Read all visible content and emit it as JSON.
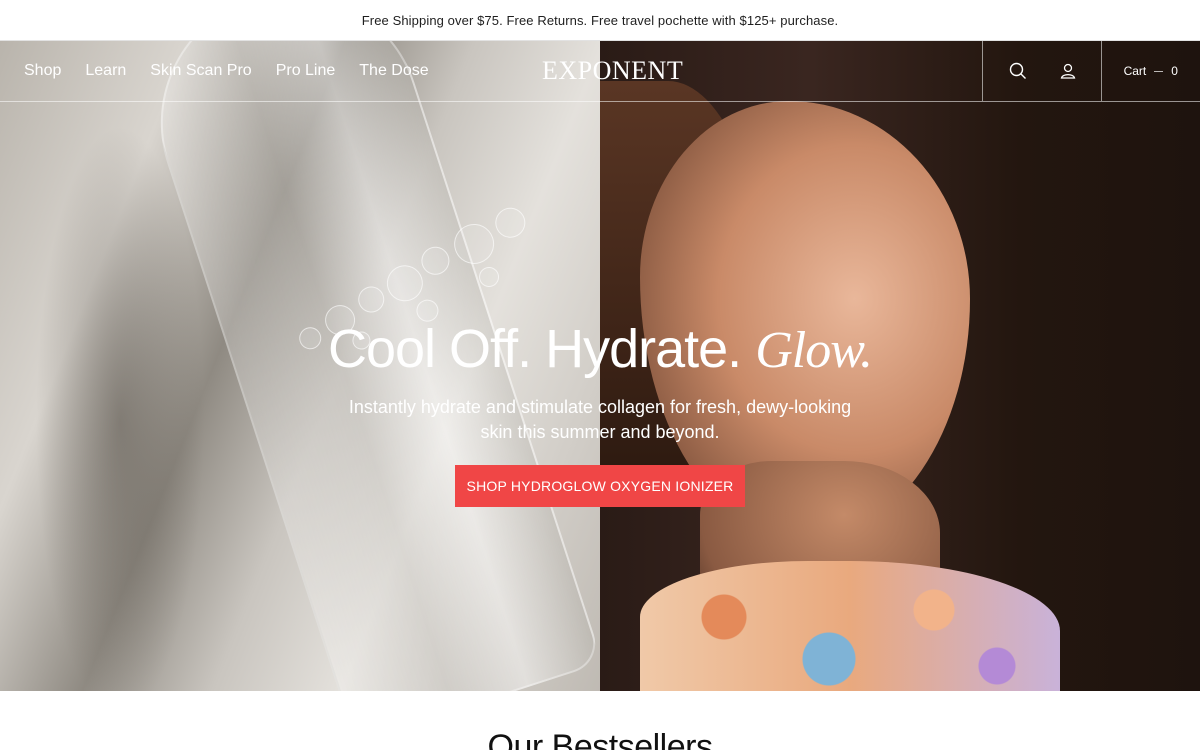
{
  "announcement": "Free Shipping over $75. Free Returns. Free travel pochette with $125+ purchase.",
  "nav": {
    "links": [
      "Shop",
      "Learn",
      "Skin Scan Pro",
      "Pro Line",
      "The Dose"
    ],
    "logo": "EXPONENT",
    "cart_label": "Cart",
    "cart_count": "0",
    "icons": [
      "search-icon",
      "account-icon"
    ]
  },
  "hero": {
    "headline_main": "Cool Off. Hydrate.",
    "headline_italic": "Glow.",
    "subtitle": "Instantly hydrate and stimulate collagen for fresh, dewy-looking skin this summer and beyond.",
    "cta_label": "SHOP HYDROGLOW OXYGEN IONIZER"
  },
  "section": {
    "title": "Our Bestsellers"
  },
  "colors": {
    "cta": "#f04646",
    "text_light": "#ffffff",
    "text_dark": "#111111"
  }
}
